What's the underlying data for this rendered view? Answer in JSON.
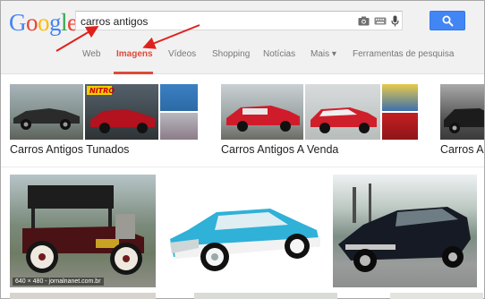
{
  "search": {
    "query": "carros antigos",
    "logo_letters": [
      {
        "char": "G",
        "color": "#4285f4"
      },
      {
        "char": "o",
        "color": "#ea4335"
      },
      {
        "char": "o",
        "color": "#fbbc05"
      },
      {
        "char": "g",
        "color": "#4285f4"
      },
      {
        "char": "l",
        "color": "#34a853"
      },
      {
        "char": "e",
        "color": "#ea4335"
      }
    ],
    "icons": [
      "camera-icon",
      "keyboard-icon",
      "microphone-icon"
    ],
    "button_icon": "search-icon"
  },
  "tabs": [
    {
      "label": "Web",
      "active": false
    },
    {
      "label": "Imagens",
      "active": true
    },
    {
      "label": "Vídeos",
      "active": false
    },
    {
      "label": "Shopping",
      "active": false
    },
    {
      "label": "Notícias",
      "active": false
    },
    {
      "label": "Mais ▾",
      "active": false
    },
    {
      "label": "Ferramentas de pesquisa",
      "active": false
    }
  ],
  "related": [
    {
      "label": "Carros Antigos Tunados"
    },
    {
      "label": "Carros Antigos A Venda"
    },
    {
      "label": "Carros Antigos"
    }
  ],
  "results": [
    {
      "meta": "640 × 480 - jornalnanet.com.br"
    },
    {
      "meta": ""
    },
    {
      "meta": ""
    }
  ],
  "colors": {
    "accent": "#dd4b39",
    "search_button": "#4285f4",
    "annotation_arrow": "#e0201b"
  }
}
